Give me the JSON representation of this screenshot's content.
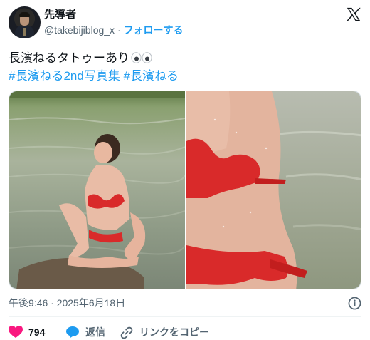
{
  "user": {
    "name": "先導者",
    "handle": "@takebijiblog_x",
    "separator": "·",
    "follow_label": "フォローする"
  },
  "tweet": {
    "text": "長濱ねるタトゥーあり",
    "hashtags": [
      "#長濱ねる2nd写真集",
      "#長濱ねる"
    ]
  },
  "media": {
    "count": 2,
    "photos": [
      {
        "name": "photo-left",
        "subject": "woman in red bikini sitting on rock in water"
      },
      {
        "name": "photo-right",
        "subject": "close-up of red bikini torso with water droplets"
      }
    ]
  },
  "meta": {
    "timestamp": "午後9:46 · 2025年6月18日"
  },
  "actions": {
    "like_count": "794",
    "reply_label": "返信",
    "copy_link_label": "リンクをコピー"
  },
  "colors": {
    "accent": "#1d9bf0",
    "like": "#f91880",
    "muted": "#536471",
    "text": "#0f1419"
  },
  "icons": [
    "x-logo-icon",
    "eyes-emoji-icon",
    "info-icon",
    "heart-icon",
    "reply-bubble-icon",
    "link-icon"
  ]
}
